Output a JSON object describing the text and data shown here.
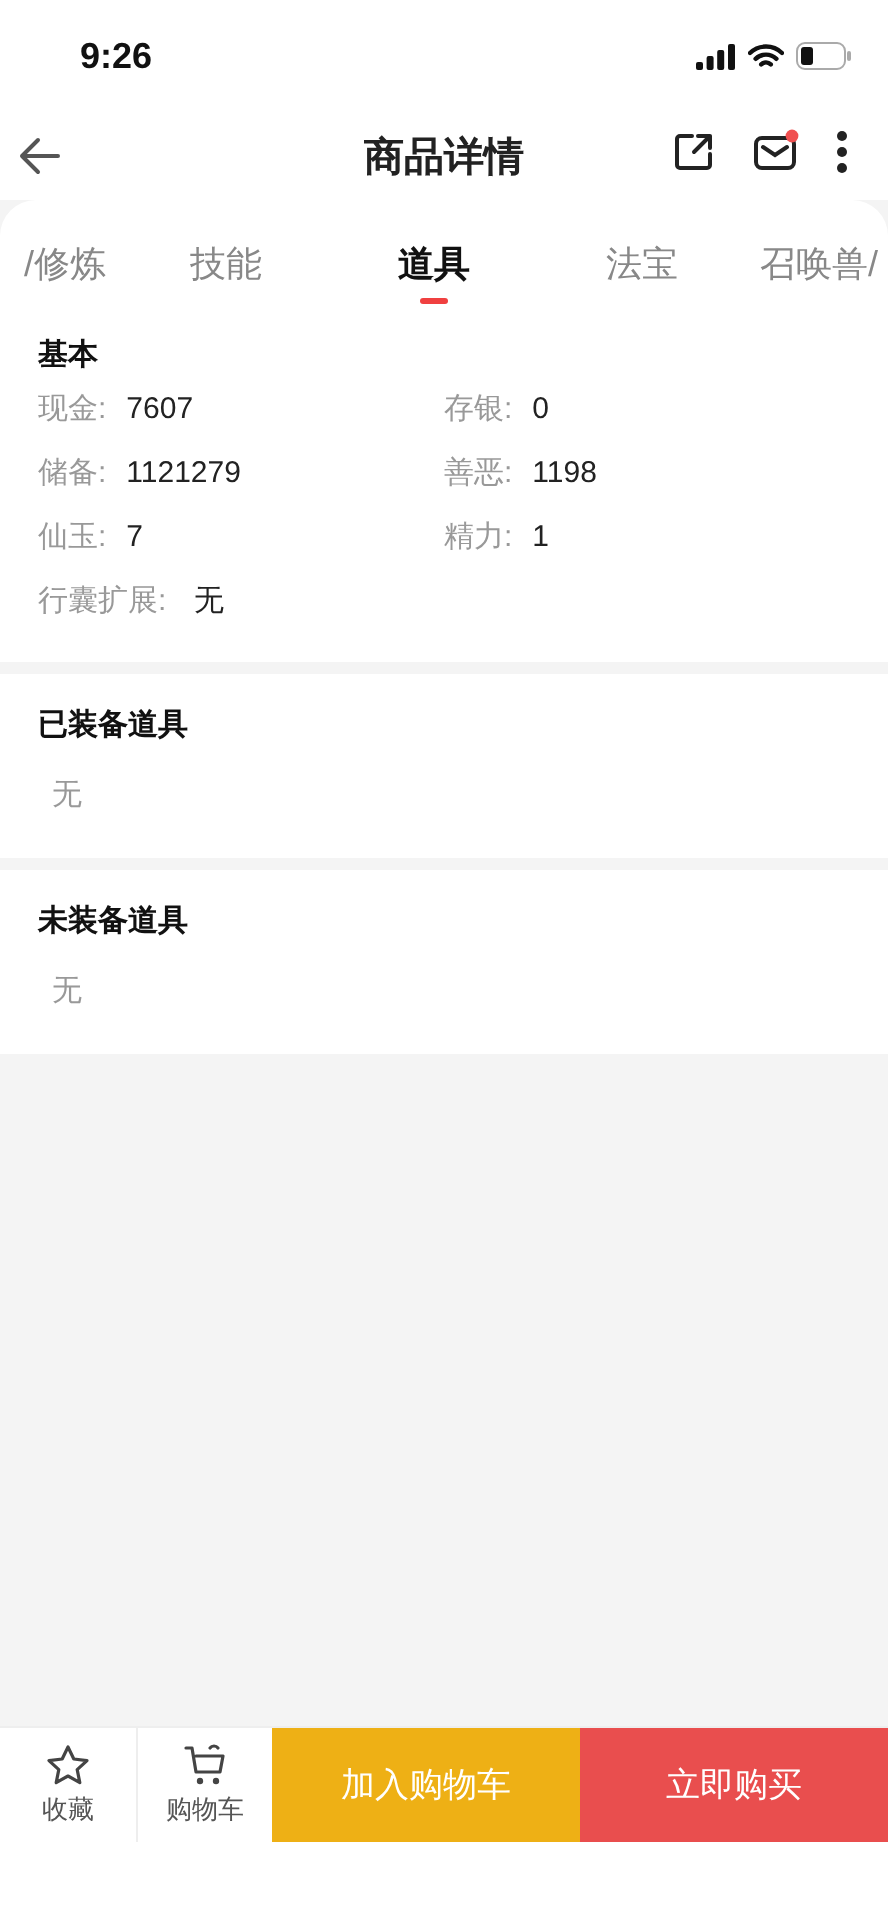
{
  "status_bar": {
    "time": "9:26"
  },
  "header": {
    "title": "商品详情",
    "has_notification": true
  },
  "tabs": [
    {
      "label": "/修炼",
      "selected": false
    },
    {
      "label": "技能",
      "selected": false
    },
    {
      "label": "道具",
      "selected": true
    },
    {
      "label": "法宝",
      "selected": false
    },
    {
      "label": "召唤兽/",
      "selected": false
    }
  ],
  "basic": {
    "title": "基本",
    "fields": [
      {
        "label": "现金:",
        "value": "7607"
      },
      {
        "label": "存银:",
        "value": "0"
      },
      {
        "label": "储备:",
        "value": "1121279"
      },
      {
        "label": "善恶:",
        "value": "1198"
      },
      {
        "label": "仙玉:",
        "value": "7"
      },
      {
        "label": "精力:",
        "value": "1"
      }
    ],
    "extension": {
      "label": "行囊扩展:",
      "value": "无"
    }
  },
  "sections": [
    {
      "title": "已装备道具",
      "empty_text": "无"
    },
    {
      "title": "未装备道具",
      "empty_text": "无"
    }
  ],
  "bottom_bar": {
    "favorite": "收藏",
    "cart": "购物车",
    "add_to_cart": "加入购物车",
    "buy_now": "立即购买"
  }
}
